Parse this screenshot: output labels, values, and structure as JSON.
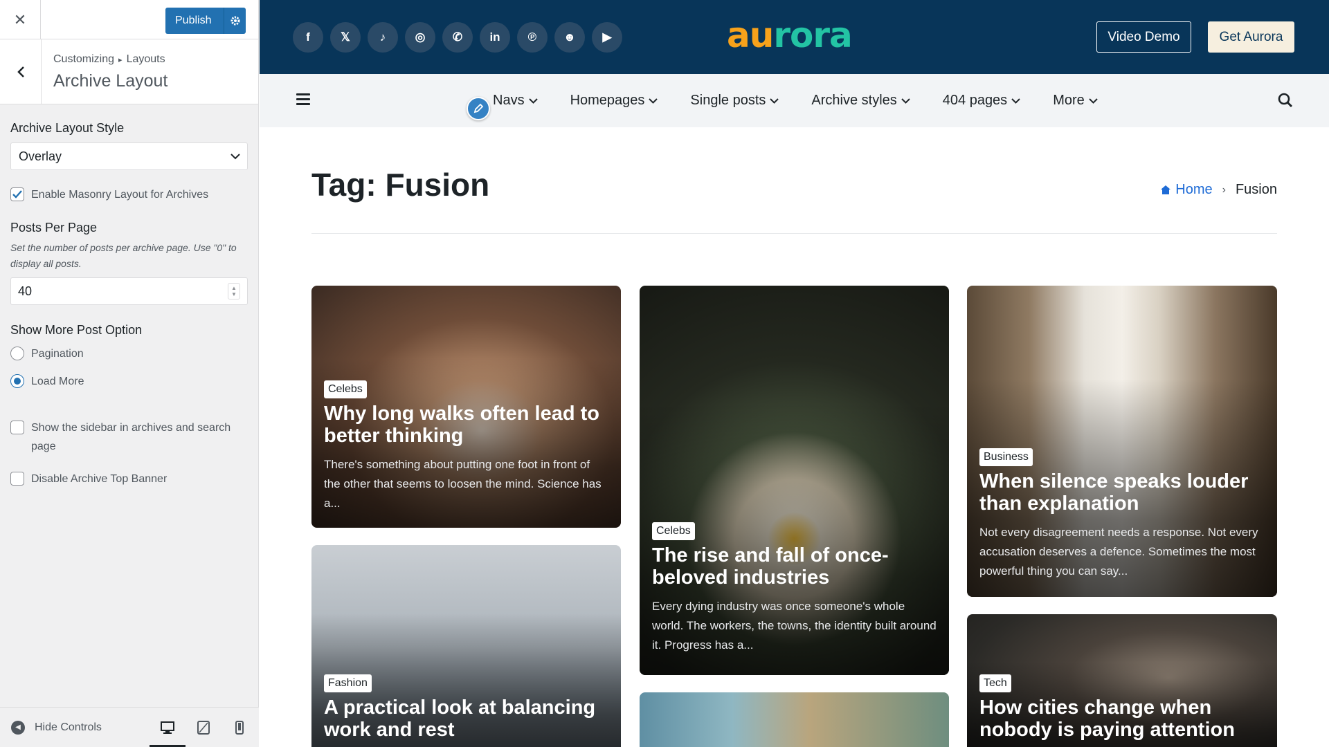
{
  "sidebar": {
    "close_icon": "close-icon",
    "publish_label": "Publish",
    "breadcrumb": [
      "Customizing",
      "Layouts"
    ],
    "section_title": "Archive Layout",
    "archive_layout_style": {
      "label": "Archive Layout Style",
      "value": "Overlay"
    },
    "masonry": {
      "label": "Enable Masonry Layout for Archives",
      "checked": true
    },
    "posts_per_page": {
      "label": "Posts Per Page",
      "description": "Set the number of posts per archive page. Use \"0\" to display all posts.",
      "value": "40"
    },
    "show_more": {
      "label": "Show More Post Option",
      "options": [
        "Pagination",
        "Load More"
      ],
      "selected": "Load More"
    },
    "show_sidebar": {
      "label": "Show the sidebar in archives and search page",
      "checked": false
    },
    "disable_banner": {
      "label": "Disable Archive Top Banner",
      "checked": false
    },
    "footer": {
      "hide_controls": "Hide Controls",
      "devices": [
        "desktop",
        "tablet",
        "mobile"
      ],
      "active_device": "desktop"
    }
  },
  "site": {
    "socials": [
      "f",
      "𝕏",
      "♪",
      "◎",
      "✆",
      "in",
      "℗",
      "☻",
      "▶"
    ],
    "logo": {
      "part1": "au",
      "part2": "rora"
    },
    "btn_demo": "Video Demo",
    "btn_get": "Get Aurora",
    "nav": [
      "Navs",
      "Homepages",
      "Single posts",
      "Archive styles",
      "404 pages",
      "More"
    ],
    "page_title": "Tag: Fusion",
    "breadcrumb": {
      "home": "Home",
      "current": "Fusion"
    },
    "accent": "#083559"
  },
  "cards": [
    {
      "category": "Celebs",
      "title": "Why long walks often lead to better thinking",
      "excerpt": "There's something about putting one foot in front of the other that seems to loosen the mind. Science has a..."
    },
    {
      "category": "Celebs",
      "title": "The rise and fall of once-beloved industries",
      "excerpt": "Every dying industry was once someone's whole world. The workers, the towns, the identity built around it. Progress has a..."
    },
    {
      "category": "Business",
      "title": "When silence speaks louder than explanation",
      "excerpt": "Not every disagreement needs a response. Not every accusation deserves a defence. Sometimes the most powerful thing you can say..."
    },
    {
      "category": "Fashion",
      "title": "A practical look at balancing work and rest",
      "excerpt": ""
    },
    {
      "category": "Tech",
      "title": "How cities change when nobody is paying attention",
      "excerpt": ""
    }
  ]
}
